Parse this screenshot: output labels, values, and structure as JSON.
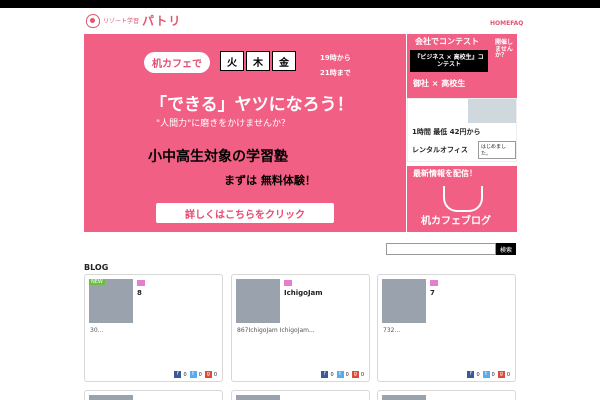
{
  "site": {
    "logo_small": "リゾート学習",
    "logo_main": "パトリ"
  },
  "nav": {
    "home": "HOME",
    "faq": "FAQ"
  },
  "slider": {
    "tag": "机カフェで",
    "days": [
      "火",
      "木",
      "金"
    ],
    "time_start": "19時から",
    "time_end": "21時まで",
    "headline": "「できる」ヤツになろう！",
    "subline": "\"人間力\"に磨きをかけませんか？",
    "line3": "小中高生対象の学習塾",
    "line4": "まずは 無料体験！",
    "cta": "詳しくはこちらをクリック"
  },
  "side_banners": {
    "b1_title": "会社でコンテスト",
    "b1_box": "『ビジネス × 高校生』コンテスト",
    "b1_side": "開催しませんか？",
    "b1_bottom": "御社 × 高校生",
    "b2_line1": "1時間 最低 42円から",
    "b2_tag": "はじめました。",
    "b2_line2": "レンタルオフィス",
    "b3_line1": "最新情報を配信！",
    "b3_line2": "机カフェブログ"
  },
  "search": {
    "placeholder": "",
    "button": "検索"
  },
  "blog": {
    "label": "BLOG",
    "cards": [
      {
        "badge": "NEW",
        "title": "8",
        "excerpt": "30...",
        "fb": "0",
        "tw": "0",
        "gp": "0"
      },
      {
        "badge": "",
        "title": "IchigoJam",
        "excerpt": "867IchigoJam IchigoJam...",
        "fb": "0",
        "tw": "0",
        "gp": "0"
      },
      {
        "badge": "",
        "title": "7",
        "excerpt": "732...",
        "fb": "0",
        "tw": "0",
        "gp": "0"
      }
    ]
  },
  "colors": {
    "brand_pink": "#f25f84",
    "logo_pink": "#e0566f",
    "category_chip": "#e47ecd"
  }
}
